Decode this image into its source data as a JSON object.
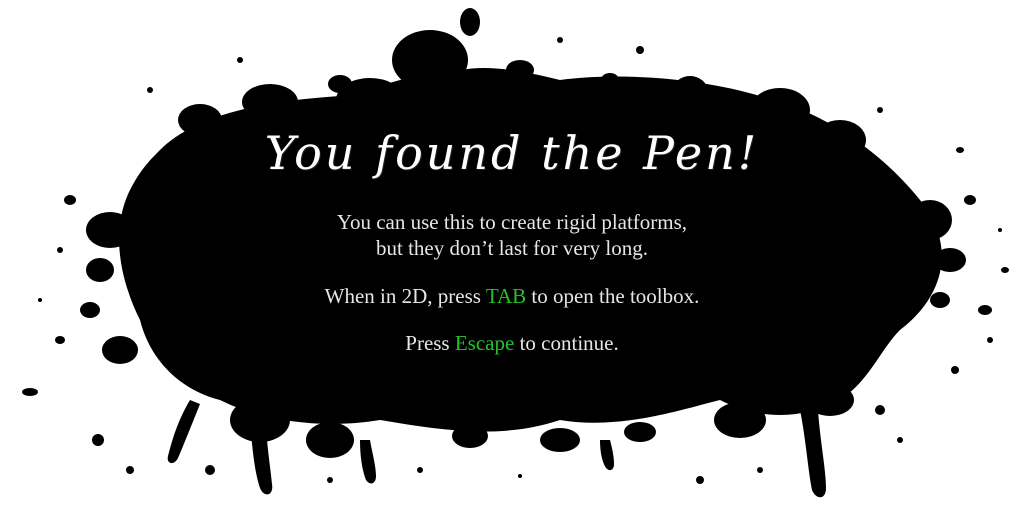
{
  "dialog": {
    "title": "You found the Pen!",
    "description_line1": "You can use this to create rigid platforms,",
    "description_line2": "but they don’t last for very long.",
    "hint_prefix": "When in 2D, press",
    "hint_key": "TAB",
    "hint_suffix": "to open the toolbox.",
    "continue_prefix": "Press",
    "continue_key": "Escape",
    "continue_suffix": "to continue."
  },
  "colors": {
    "background": "#ffffff",
    "ink_splat": "#000000",
    "title_text": "#ffffff",
    "body_text": "#e6e6e6",
    "key_highlight": "#22c42a"
  },
  "icons": {
    "backdrop": "ink-splat"
  }
}
